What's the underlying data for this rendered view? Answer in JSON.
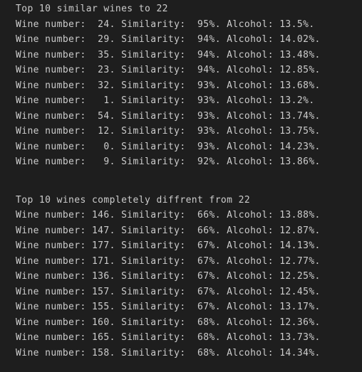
{
  "similar": {
    "header": "Top 10 similar wines to 22",
    "lines": [
      "Wine number:  24. Similarity:  95%. Alcohol: 13.5%.",
      "Wine number:  29. Similarity:  94%. Alcohol: 14.02%.",
      "Wine number:  35. Similarity:  94%. Alcohol: 13.48%.",
      "Wine number:  23. Similarity:  94%. Alcohol: 12.85%.",
      "Wine number:  32. Similarity:  93%. Alcohol: 13.68%.",
      "Wine number:   1. Similarity:  93%. Alcohol: 13.2%.",
      "Wine number:  54. Similarity:  93%. Alcohol: 13.74%.",
      "Wine number:  12. Similarity:  93%. Alcohol: 13.75%.",
      "Wine number:   0. Similarity:  93%. Alcohol: 14.23%.",
      "Wine number:   9. Similarity:  92%. Alcohol: 13.86%."
    ]
  },
  "different": {
    "header": "Top 10 wines completely diffrent from 22",
    "lines": [
      "Wine number: 146. Similarity:  66%. Alcohol: 13.88%.",
      "Wine number: 147. Similarity:  66%. Alcohol: 12.87%.",
      "Wine number: 177. Similarity:  67%. Alcohol: 14.13%.",
      "Wine number: 171. Similarity:  67%. Alcohol: 12.77%.",
      "Wine number: 136. Similarity:  67%. Alcohol: 12.25%.",
      "Wine number: 157. Similarity:  67%. Alcohol: 12.45%.",
      "Wine number: 155. Similarity:  67%. Alcohol: 13.17%.",
      "Wine number: 160. Similarity:  68%. Alcohol: 12.36%.",
      "Wine number: 165. Similarity:  68%. Alcohol: 13.73%.",
      "Wine number: 158. Similarity:  68%. Alcohol: 14.34%."
    ]
  }
}
